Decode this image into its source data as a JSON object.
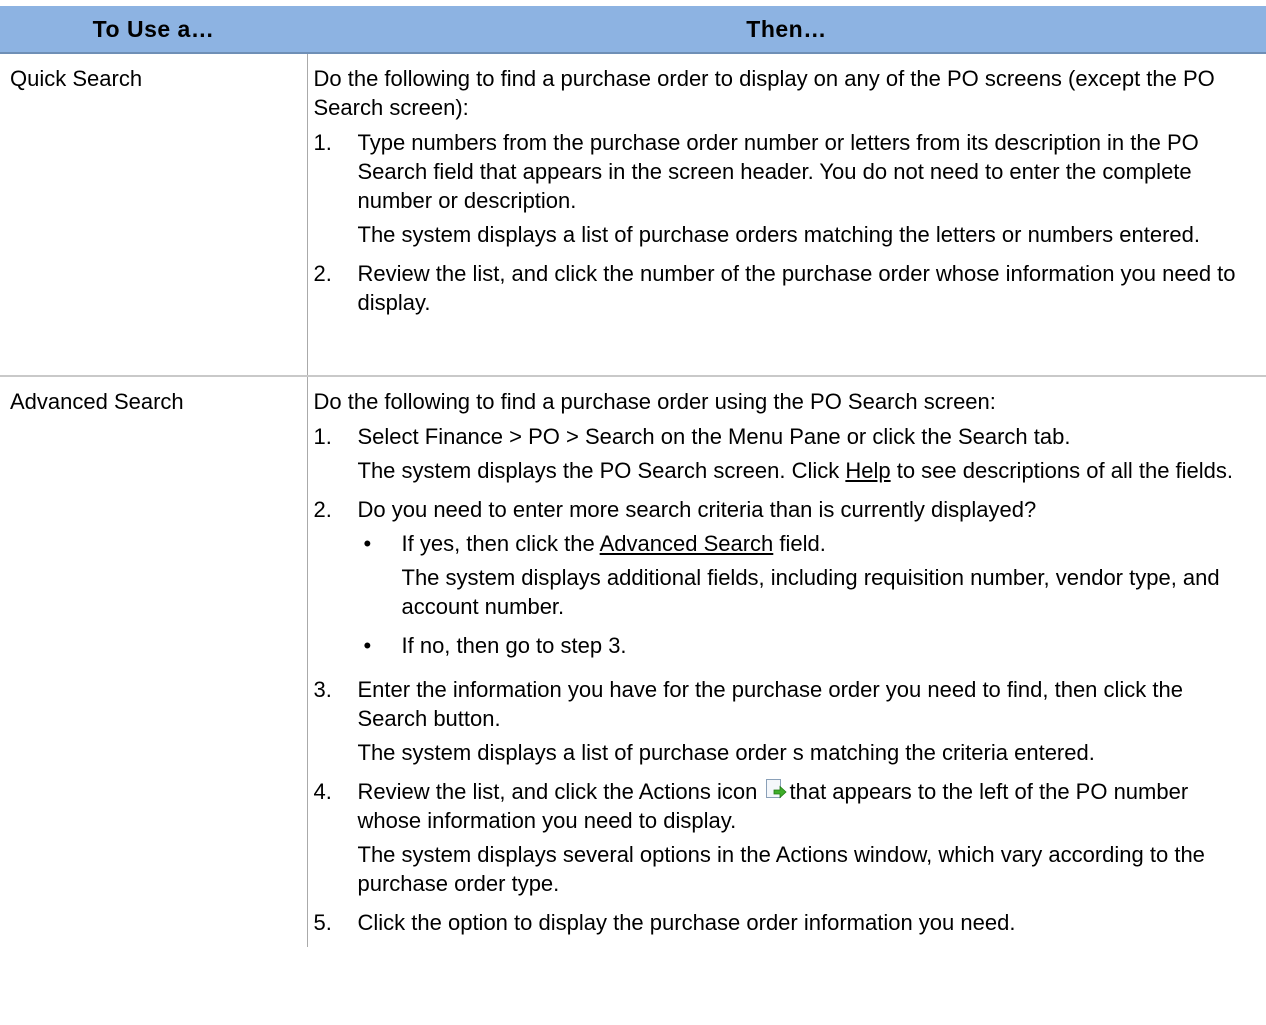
{
  "header": {
    "col1": "To Use a…",
    "col2": "Then…"
  },
  "quick": {
    "label": "Quick Search",
    "intro": "Do the following to find a purchase order to display on any of the PO screens (except the PO Search screen):",
    "steps": [
      {
        "num": "1.",
        "text": "Type numbers from the purchase order number or letters from its description in the PO Search field that appears in the screen header. You do not need to enter the complete number or description.",
        "note": "The system displays a list of purchase orders matching the letters or numbers entered."
      },
      {
        "num": "2.",
        "text": "Review the list, and click the number of the purchase order whose information you need to display."
      }
    ]
  },
  "advanced": {
    "label": "Advanced Search",
    "intro": "Do the following to find a purchase order using the PO Search screen:",
    "step1": {
      "num": "1.",
      "text": "Select Finance > PO > Search on the Menu Pane or click the Search tab.",
      "note_before": "The system displays the PO Search screen. Click ",
      "help_link": "Help",
      "note_after": " to see descriptions of all the fields."
    },
    "step2": {
      "num": "2.",
      "text": "Do you need to enter more search criteria than is currently displayed?",
      "bullet_symbol": "•",
      "yes_before": "If yes, then click the ",
      "yes_link": "Advanced Search",
      "yes_after": " field.",
      "yes_note": "The system displays additional fields, including requisition number, vendor type, and account number.",
      "no_text": "If no, then go to step 3."
    },
    "step3": {
      "num": "3.",
      "text": "Enter the information you have for the purchase order you need to find, then click the Search button.",
      "note": "The system displays a list of purchase order s matching the criteria entered."
    },
    "step4": {
      "num": "4.",
      "text_before": "Review the list, and click the Actions icon",
      "icon": "actions-icon",
      "text_after": "that appears to the left of the PO number whose information you need to display.",
      "note": "The system displays several options in the Actions window, which vary according to the purchase order type."
    },
    "step5": {
      "num": "5.",
      "text": "Click the option to display the purchase order information you need."
    }
  }
}
